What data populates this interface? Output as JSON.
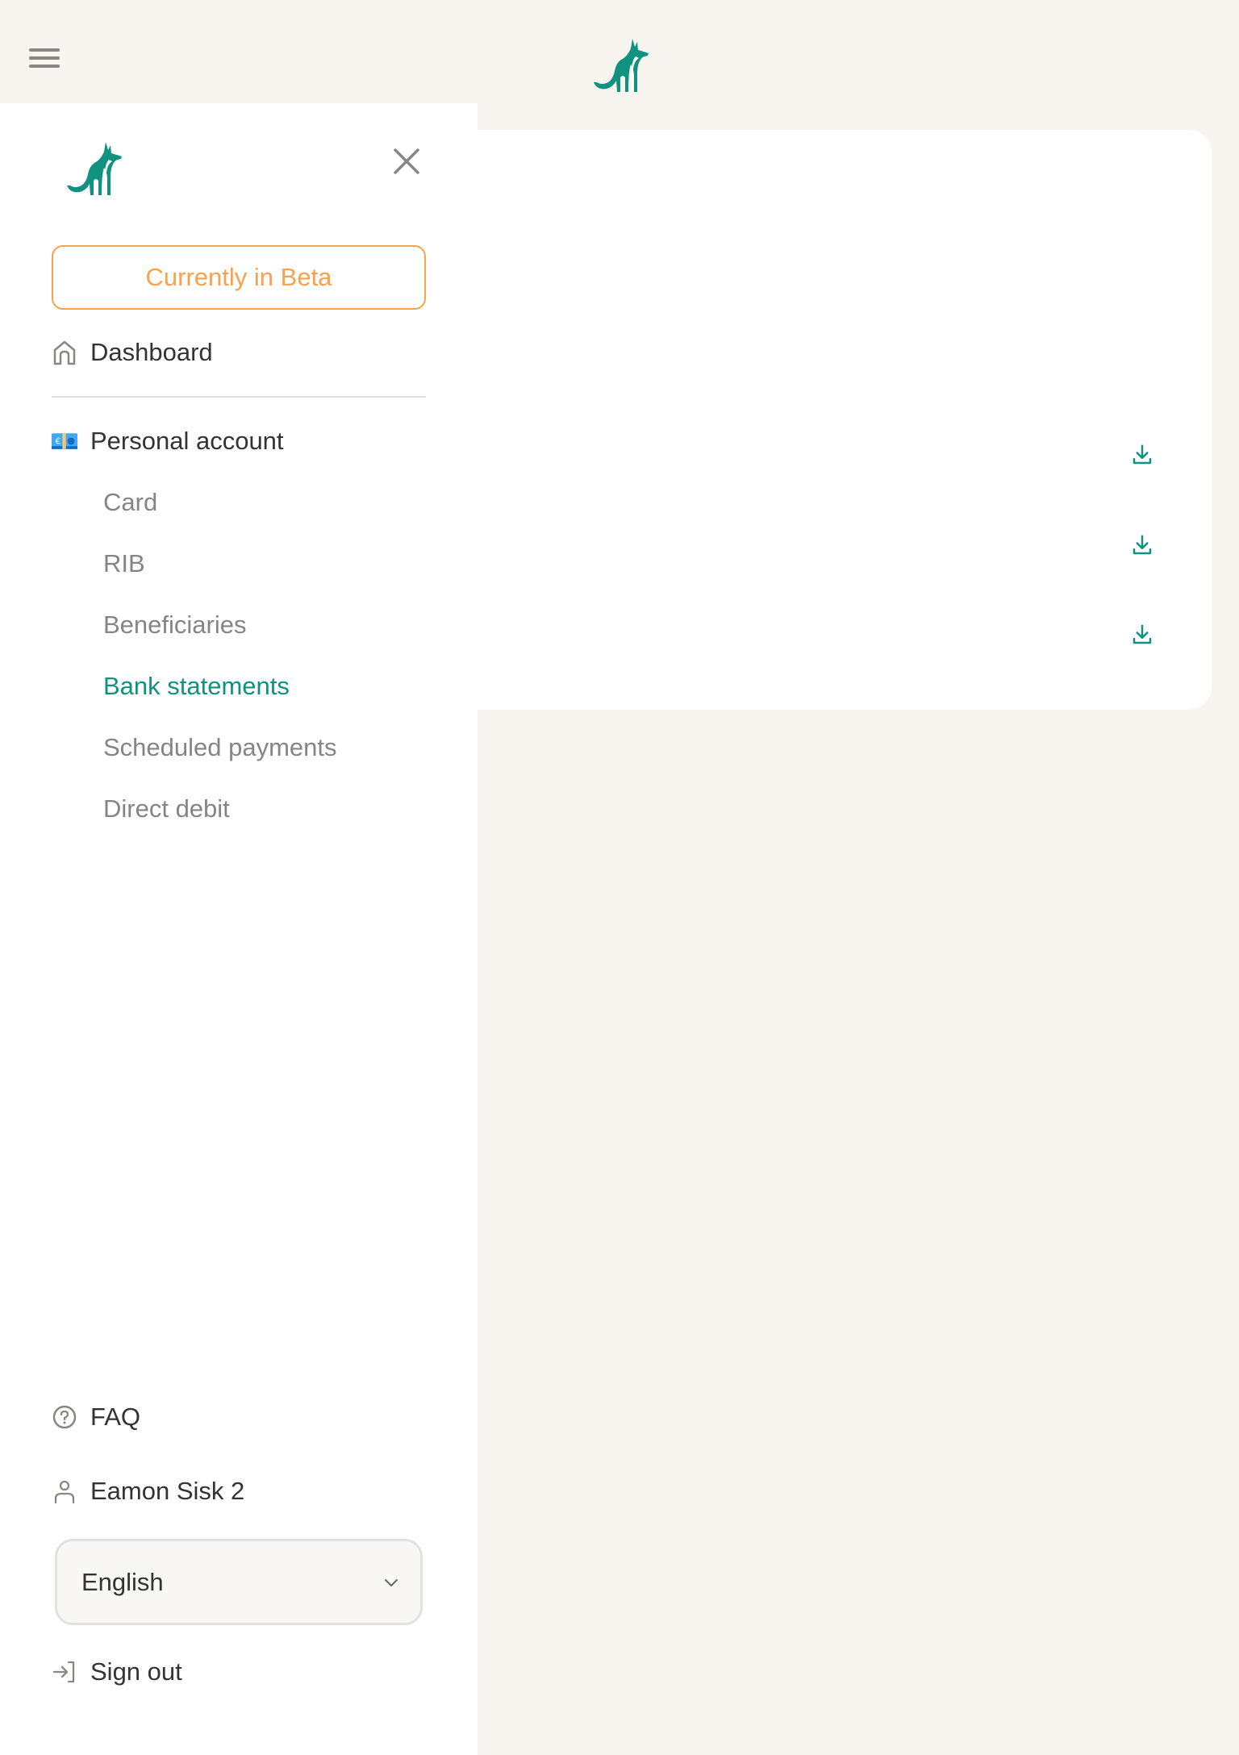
{
  "header": {
    "menu_icon": "hamburger-icon",
    "logo_icon": "fox-logo-icon"
  },
  "drawer": {
    "logo_icon": "fox-logo-icon",
    "close_icon": "close-icon",
    "beta_label": "Currently in Beta",
    "dashboard": {
      "label": "Dashboard",
      "icon": "home-icon"
    },
    "account_section": {
      "label": "Personal account",
      "icon": "euro-banknote-icon",
      "items": [
        {
          "label": "Card",
          "active": false
        },
        {
          "label": "RIB",
          "active": false
        },
        {
          "label": "Beneficiaries",
          "active": false
        },
        {
          "label": "Bank statements",
          "active": true
        },
        {
          "label": "Scheduled payments",
          "active": false
        },
        {
          "label": "Direct debit",
          "active": false
        }
      ]
    },
    "footer": {
      "faq": {
        "label": "FAQ",
        "icon": "help-circle-icon"
      },
      "user": {
        "label": "Eamon Sisk 2",
        "icon": "user-icon"
      },
      "language": {
        "selected": "English",
        "icon": "chevron-down-icon"
      },
      "sign_out": {
        "label": "Sign out",
        "icon": "sign-out-icon"
      }
    }
  },
  "main": {
    "statements": [
      {
        "icon": "download-icon"
      },
      {
        "icon": "download-icon"
      },
      {
        "icon": "download-icon"
      }
    ]
  },
  "colors": {
    "accent": "#11917F",
    "beta": "#F7A24E",
    "background": "#F8F4EF"
  }
}
